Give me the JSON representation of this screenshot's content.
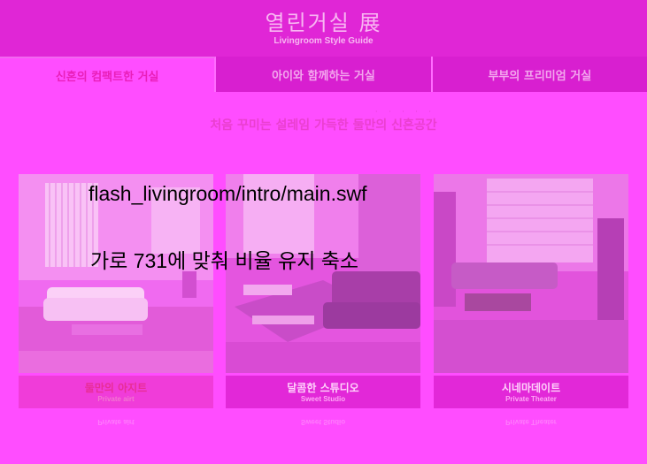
{
  "header": {
    "title": "열린거실 展",
    "subtitle": "Livingroom Style Guide"
  },
  "tabs": [
    {
      "label": "신혼의 컴팩트한 거실",
      "active": true
    },
    {
      "label": "아이와 함께하는 거실",
      "active": false
    },
    {
      "label": "부부의 프리미엄 거실",
      "active": false
    }
  ],
  "tagline": "처음 꾸미는 설레임 가득한 둘만의 신혼공간",
  "cards": [
    {
      "title": "둘만의 아지트",
      "subtitle": "Private airt",
      "icon": "room-photo"
    },
    {
      "title": "달콤한 스튜디오",
      "subtitle": "Sweet Studio",
      "icon": "room-photo"
    },
    {
      "title": "시네마데이트",
      "subtitle": "Private Theater",
      "icon": "room-photo"
    }
  ],
  "overlay": {
    "path": "flash_livingroom/intro/main.swf",
    "note": "가로 731에 맞춰 비율 유지 축소"
  },
  "colors": {
    "background": "#ff4dff",
    "header": "#e026d6",
    "accent": "#e91fb9"
  }
}
